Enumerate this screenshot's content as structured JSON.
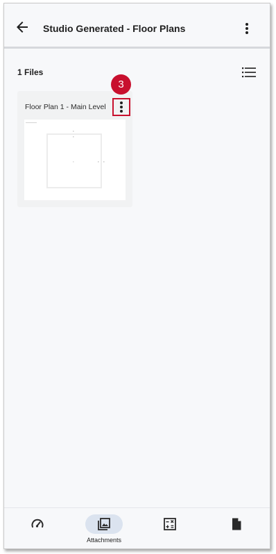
{
  "header": {
    "title": "Studio Generated - Floor Plans",
    "back_icon": "arrow-back-icon",
    "menu_icon": "more-vertical-icon"
  },
  "content": {
    "file_count": "1 Files",
    "view_icon": "list-view-icon",
    "files": [
      {
        "name": "Floor Plan 1 - Main Level",
        "menu_icon": "more-vertical-icon",
        "thumbnail": "floor-plan-thumbnail"
      }
    ],
    "step_badge": "3"
  },
  "bottom_nav": {
    "items": [
      {
        "icon": "speedometer-icon",
        "label": ""
      },
      {
        "icon": "image-gallery-icon",
        "label": "Attachments",
        "active": true
      },
      {
        "icon": "calculator-icon",
        "label": ""
      },
      {
        "icon": "document-icon",
        "label": ""
      }
    ]
  },
  "colors": {
    "accent": "#c8102e",
    "active_pill": "#dbe3ef",
    "header_bg": "#f7f8fa"
  }
}
